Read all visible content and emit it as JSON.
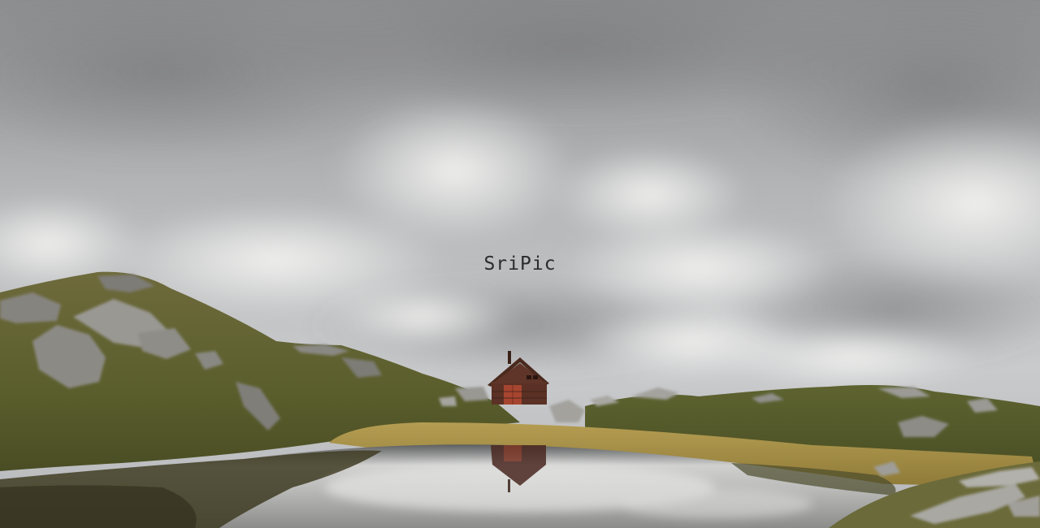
{
  "site": {
    "title": "SriPic"
  },
  "hero": {
    "subject": "cabin-by-mountain-lake",
    "colors": {
      "sky": "#b8b9ba",
      "cloud_light": "#f1f1f0",
      "hill_green": "#5d6231",
      "grass_gold": "#a68f45",
      "rock_grey": "#8f8e8a",
      "cabin_brown": "#5a3124",
      "door_red": "#a64530",
      "water": "#6e6f70"
    }
  }
}
